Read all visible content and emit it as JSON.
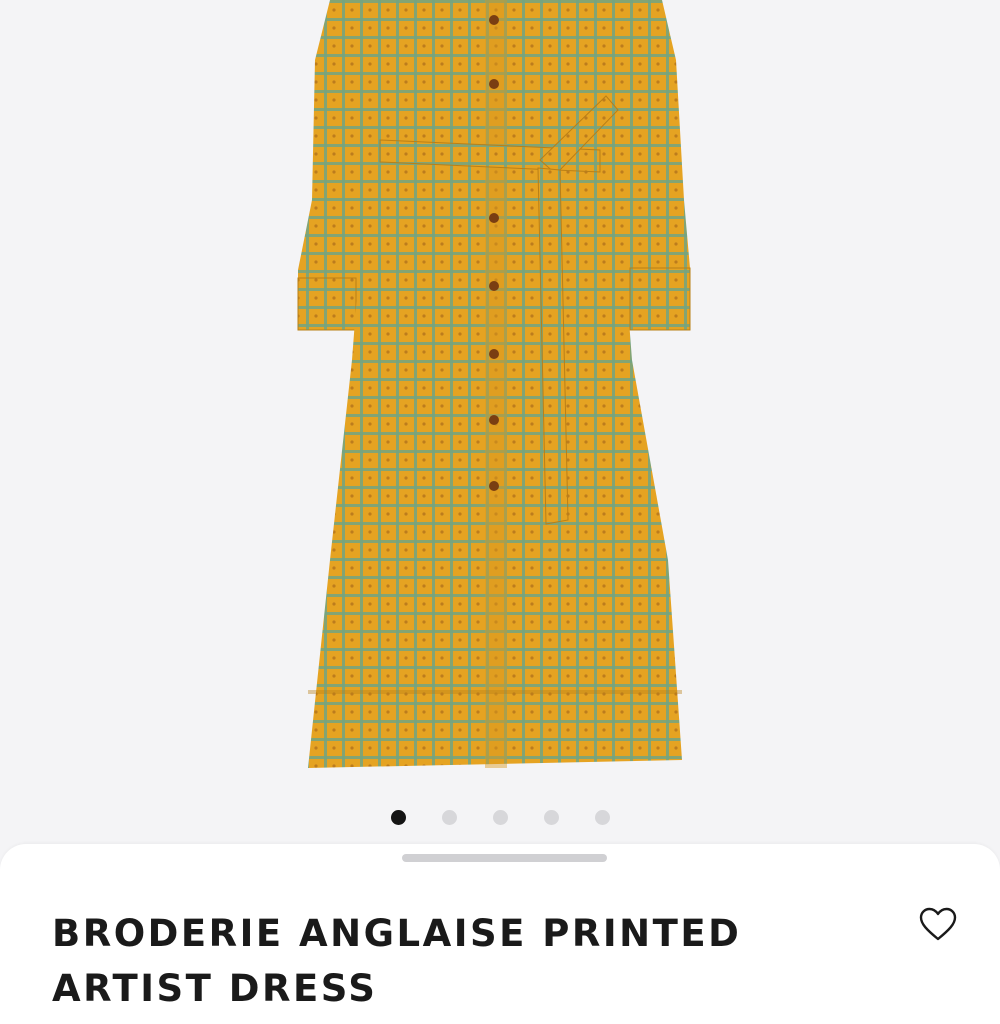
{
  "product": {
    "title": "BRODERIE ANGLAISE PRINTED ARTIST DRESS",
    "image_description_icon": "dress-image",
    "dress_color": "#e7a524",
    "grid_color": "#6aa37e"
  },
  "gallery": {
    "total_images": 5,
    "active_index": 0
  },
  "actions": {
    "favorite_icon": "heart-outline-icon"
  },
  "colors": {
    "background": "#f4f4f6",
    "sheet": "#ffffff",
    "text": "#1a1a1a",
    "dot_active": "#141414",
    "dot_inactive": "#d7d7da"
  }
}
